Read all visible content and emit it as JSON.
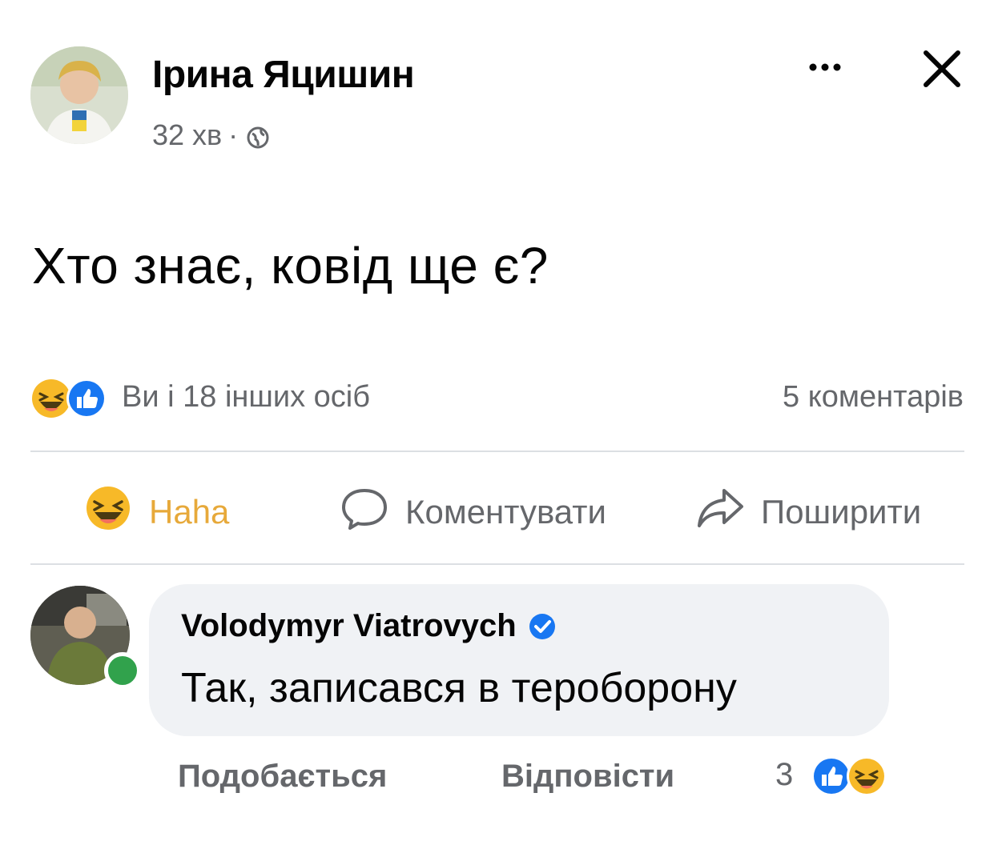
{
  "post": {
    "author": "Ірина Яцишин",
    "time": "32 хв",
    "separator": "·",
    "text": "Хто знає, ковід ще є?",
    "reactions_text": "Ви і 18 інших осіб",
    "comments_text": "5 коментарів"
  },
  "actions": {
    "haha_label": "Haha",
    "comment_label": "Коментувати",
    "share_label": "Поширити"
  },
  "comment": {
    "author": "Volodymyr Viatrovych",
    "text": "Так, записався в тероборону",
    "like_label": "Подобається",
    "reply_label": "Відповісти",
    "reaction_count": "3"
  },
  "icons": {
    "more": "more-icon",
    "close": "close-icon",
    "globe": "globe-icon",
    "like": "like-reaction-icon",
    "haha": "haha-reaction-icon",
    "comment": "comment-bubble-icon",
    "share": "share-arrow-icon",
    "verified": "verified-badge-icon"
  },
  "colors": {
    "like_blue": "#1877f2",
    "haha_yellow": "#f7b928",
    "secondary_text": "#65676b",
    "online_green": "#31a24c",
    "bubble_bg": "#f0f2f5"
  }
}
